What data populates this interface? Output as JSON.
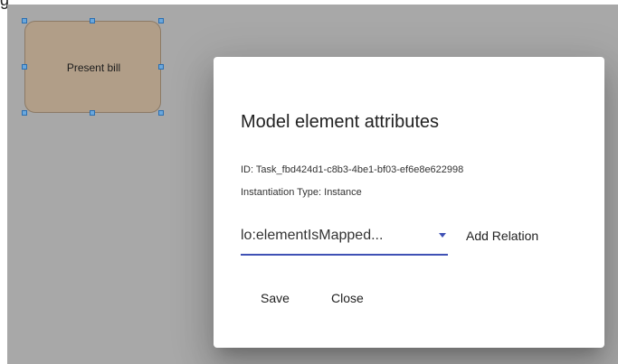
{
  "canvas": {
    "corner_label": "g",
    "task": {
      "label": "Present bill"
    }
  },
  "dialog": {
    "title": "Model element attributes",
    "id_line": "ID: Task_fbd424d1-c8b3-4be1-bf03-ef6e8e622998",
    "type_line": "Instantiation Type: Instance",
    "relation_select": {
      "value": "lo:elementIsMapped..."
    },
    "add_relation_label": "Add Relation",
    "save_label": "Save",
    "close_label": "Close"
  },
  "colors": {
    "backdrop": "#a8a8a8",
    "task_fill": "#b19e88",
    "accent": "#3f51b5",
    "handle": "#6aa7dc"
  }
}
